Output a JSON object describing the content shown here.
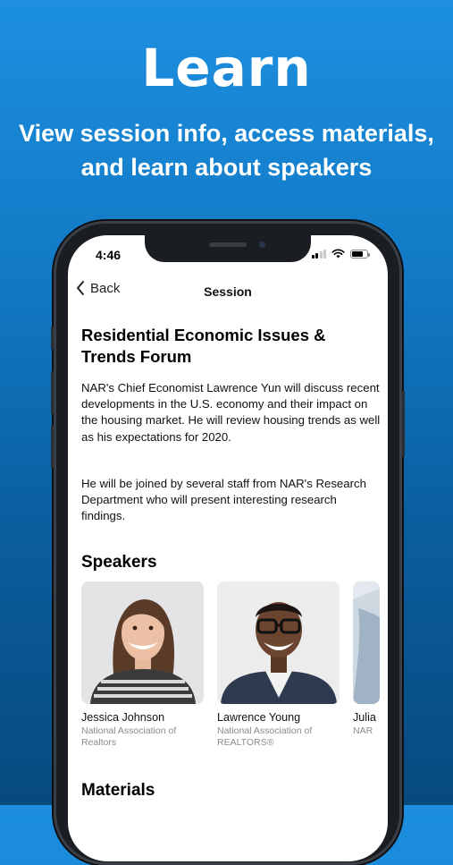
{
  "hero": {
    "title": "Learn",
    "subtitle_line1": "View session info, access materials,",
    "subtitle_line2": "and learn about speakers"
  },
  "status_bar": {
    "time": "4:46"
  },
  "nav": {
    "back_label": "Back",
    "title": "Session"
  },
  "session": {
    "title": "Residential Economic Issues & Trends Forum",
    "description": [
      "NAR's Chief Economist Lawrence Yun will discuss recent developments in the U.S. economy and their impact on the housing market. He will review housing trends as well as his expectations for 2020.",
      "He will be joined by several staff from NAR's Research Department who will present interesting research findings."
    ]
  },
  "speakers": {
    "heading": "Speakers",
    "items": [
      {
        "name": "Jessica Johnson",
        "org": "National Association of Realtors"
      },
      {
        "name": "Lawrence Young",
        "org": "National Association of REALTORS®"
      },
      {
        "name": "Julia",
        "org": "NAR"
      }
    ]
  },
  "materials": {
    "heading": "Materials"
  },
  "colors": {
    "bg_top": "#1d8fe0",
    "bg_bottom": "#074a7e",
    "text_white": "#ffffff",
    "muted": "#8a8a8a"
  },
  "icons": [
    "chevron-left-icon",
    "signal-icon",
    "wifi-icon",
    "battery-icon"
  ]
}
